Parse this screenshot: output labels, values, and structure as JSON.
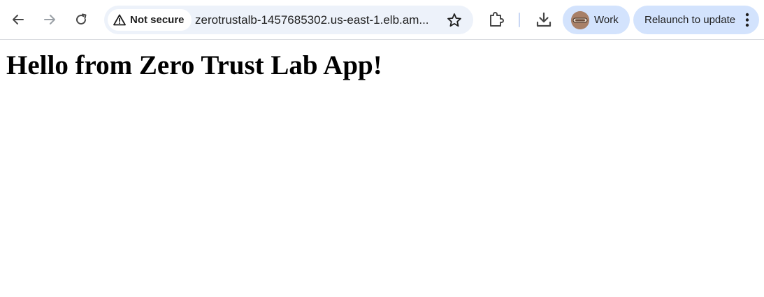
{
  "browser": {
    "security_label": "Not secure",
    "url": "zerotrustalb-1457685302.us-east-1.elb.am...",
    "profile_label": "Work",
    "relaunch_label": "Relaunch to update"
  },
  "page": {
    "heading": "Hello from Zero Trust Lab App!"
  },
  "colors": {
    "omnibox_bg": "#edf2fa",
    "chip_bg": "#d3e3fd",
    "icon": "#474747"
  }
}
